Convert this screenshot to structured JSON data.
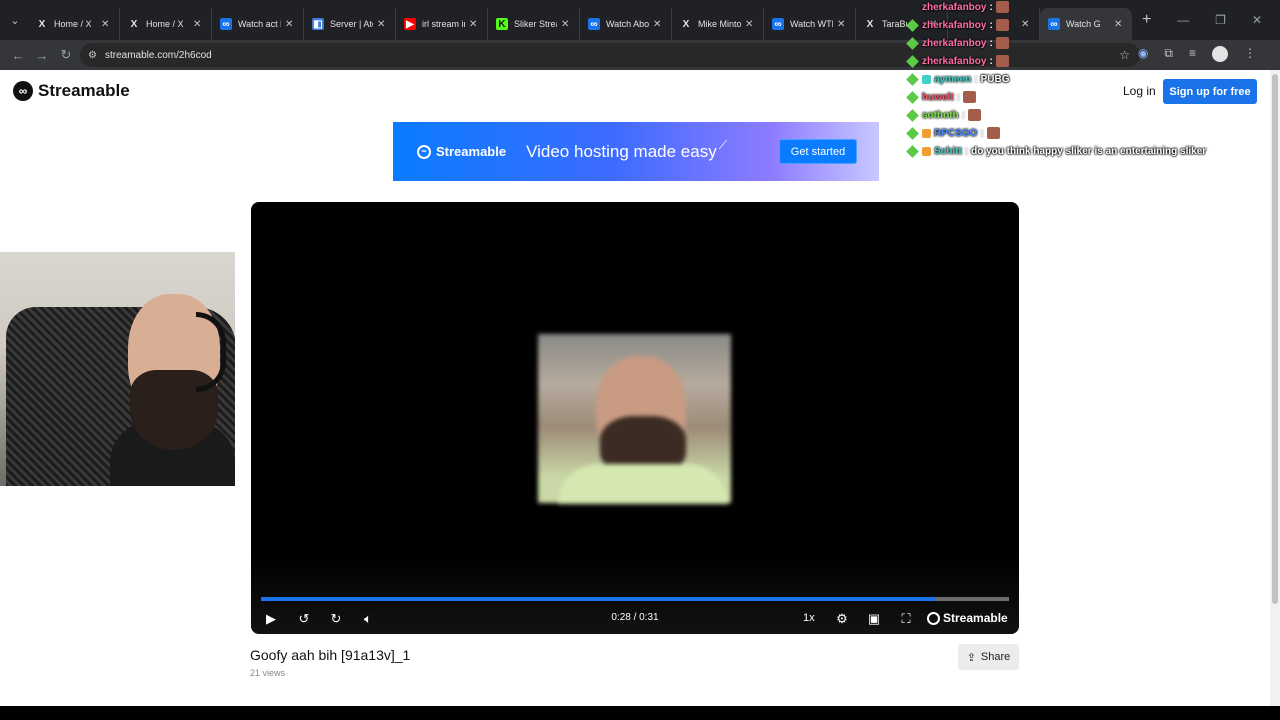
{
  "browser": {
    "tabs": [
      {
        "title": "Home / X",
        "icon": "x-icon",
        "fav_color": "#e3e3e3",
        "fav_bg": "transparent",
        "glyph": "X"
      },
      {
        "title": "Home / X",
        "icon": "x-icon",
        "fav_color": "#e3e3e3",
        "fav_bg": "transparent",
        "glyph": "X"
      },
      {
        "title": "Watch act lik",
        "icon": "streamable-icon",
        "fav_color": "#fff",
        "fav_bg": "#1a73e8",
        "glyph": "∞"
      },
      {
        "title": "Server | Aten",
        "icon": "server-icon",
        "fav_color": "#fff",
        "fav_bg": "#3d7bd9",
        "glyph": "◧"
      },
      {
        "title": "irl stream in",
        "icon": "youtube-icon",
        "fav_color": "#fff",
        "fav_bg": "#ff0000",
        "glyph": "▶"
      },
      {
        "title": "Sliker Stream",
        "icon": "kick-icon",
        "fav_color": "#111",
        "fav_bg": "#53fc18",
        "glyph": "K"
      },
      {
        "title": "Watch Abou",
        "icon": "streamable-icon",
        "fav_color": "#fff",
        "fav_bg": "#1a73e8",
        "glyph": "∞"
      },
      {
        "title": "Mike Minton",
        "icon": "x-icon",
        "fav_color": "#e3e3e3",
        "fav_bg": "transparent",
        "glyph": "X"
      },
      {
        "title": "Watch WTF",
        "icon": "streamable-icon",
        "fav_color": "#fff",
        "fav_bg": "#1a73e8",
        "glyph": "∞"
      },
      {
        "title": "TaraBull",
        "icon": "x-icon",
        "fav_color": "#e3e3e3",
        "fav_bg": "transparent",
        "glyph": "X"
      },
      {
        "title": "",
        "icon": "tab-icon",
        "fav_color": "#e3e3e3",
        "fav_bg": "transparent",
        "glyph": ""
      },
      {
        "title": "Watch G",
        "icon": "streamable-icon",
        "fav_color": "#fff",
        "fav_bg": "#1a73e8",
        "glyph": "∞",
        "active": true
      }
    ],
    "url": "streamable.com/2h6cod"
  },
  "site": {
    "logo_text": "Streamable",
    "login_label": "Log in",
    "signup_label": "Sign up for free"
  },
  "banner": {
    "logo_text": "Streamable",
    "tagline": "Video hosting made easy",
    "cta_label": "Get started"
  },
  "player": {
    "time": "0:28 / 0:31",
    "progress": 0.903,
    "speed": "1x",
    "brand": "Streamable"
  },
  "video": {
    "title": "Goofy aah bih [91a13v]_1",
    "views": "21 views",
    "share_label": "Share"
  },
  "chat": [
    {
      "user": "zherkafanboy",
      "color": "#ff6fa8",
      "text": "",
      "emote": true,
      "badge": "",
      "diamond": false
    },
    {
      "user": "zherkafanboy",
      "color": "#ff6fa8",
      "text": "",
      "emote": true,
      "badge": "",
      "diamond": true
    },
    {
      "user": "zherkafanboy",
      "color": "#ff6fa8",
      "text": "",
      "emote": true,
      "badge": "",
      "diamond": true
    },
    {
      "user": "zherkafanboy",
      "color": "#ff6fa8",
      "text": "",
      "emote": true,
      "badge": "",
      "diamond": true
    },
    {
      "user": "aymeen",
      "color": "#3fd0c8",
      "text": "PUBG",
      "emote": false,
      "badge": "#3fd0c8",
      "diamond": true
    },
    {
      "user": "huwelt",
      "color": "#ff4f6a",
      "text": "",
      "emote": true,
      "badge": "",
      "diamond": true
    },
    {
      "user": "sothoth",
      "color": "#7ee04c",
      "text": "",
      "emote": true,
      "badge": "",
      "diamond": true
    },
    {
      "user": "RPCSGO",
      "color": "#4f8cff",
      "text": "",
      "emote": true,
      "badge": "#f0a030",
      "diamond": true
    },
    {
      "user": "Schitt",
      "color": "#3fd0c8",
      "text": "do you think happy sliker is an entertaining sliker",
      "emote": false,
      "badge": "#f0a030",
      "diamond": true
    }
  ]
}
